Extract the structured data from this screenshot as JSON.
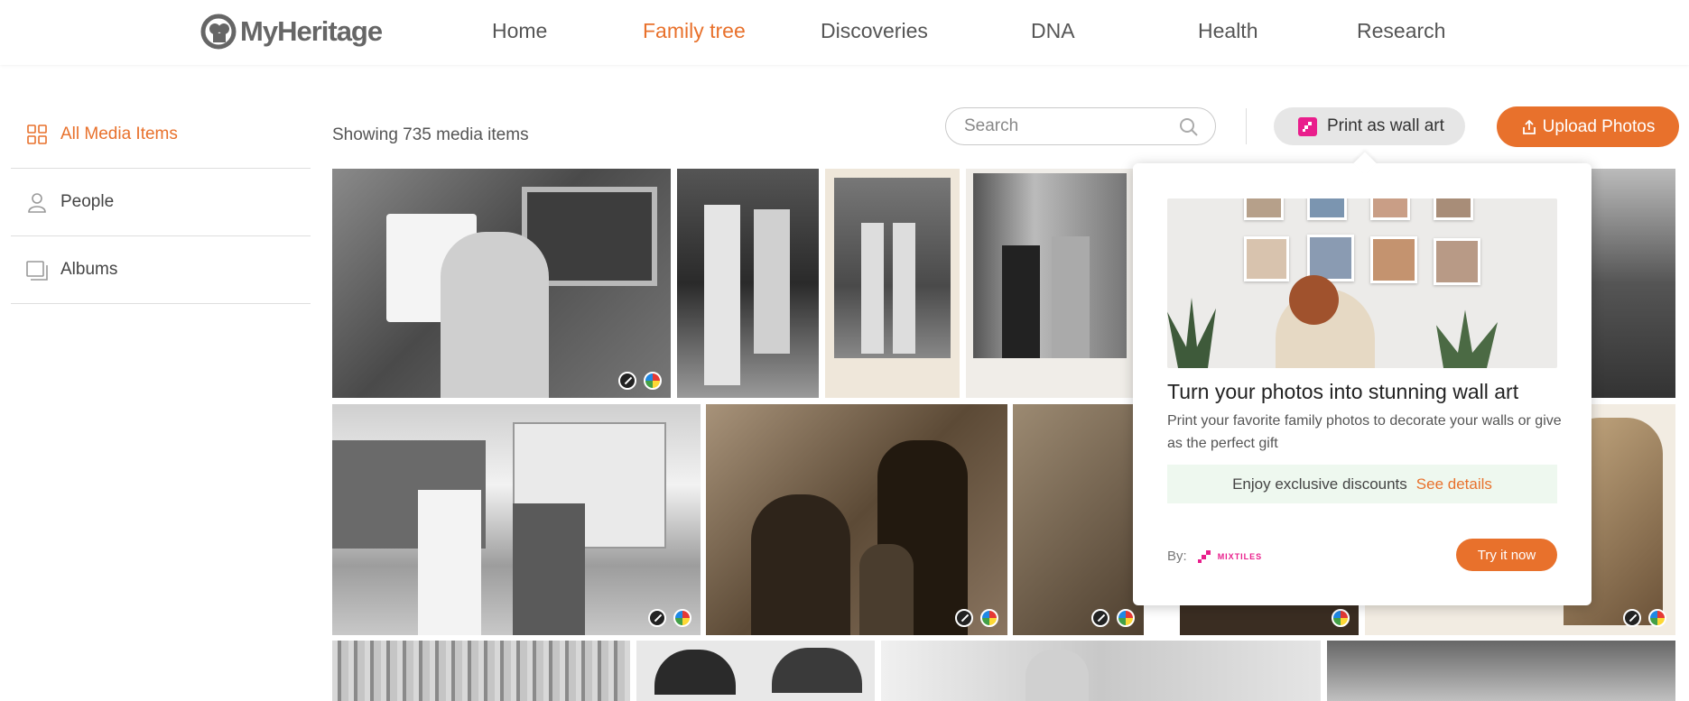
{
  "header": {
    "logo_text": "MyHeritage",
    "nav": [
      {
        "label": "Home",
        "active": false
      },
      {
        "label": "Family tree",
        "active": true
      },
      {
        "label": "Discoveries",
        "active": false
      },
      {
        "label": "DNA",
        "active": false
      },
      {
        "label": "Health",
        "active": false
      },
      {
        "label": "Research",
        "active": false
      }
    ]
  },
  "sidebar": {
    "items": [
      {
        "label": "All Media Items",
        "icon": "grid-icon",
        "active": true
      },
      {
        "label": "People",
        "icon": "person-icon",
        "active": false
      },
      {
        "label": "Albums",
        "icon": "albums-icon",
        "active": false
      }
    ]
  },
  "toolbar": {
    "showing_text": "Showing 735 media items",
    "search_placeholder": "Search",
    "search_value": "",
    "wall_art_label": "Print as wall art",
    "upload_label": "Upload Photos"
  },
  "popover": {
    "title": "Turn your photos into stunning wall art",
    "description": "Print your favorite family photos to decorate your walls or give as the perfect gift",
    "discount_text": "Enjoy exclusive discounts",
    "discount_link": "See details",
    "by_label": "By:",
    "brand": "MIXTILES",
    "cta_label": "Try it now"
  },
  "colors": {
    "accent": "#e8712c",
    "mixtiles_pink": "#e91e8c",
    "discount_bg": "#eef8ef"
  }
}
